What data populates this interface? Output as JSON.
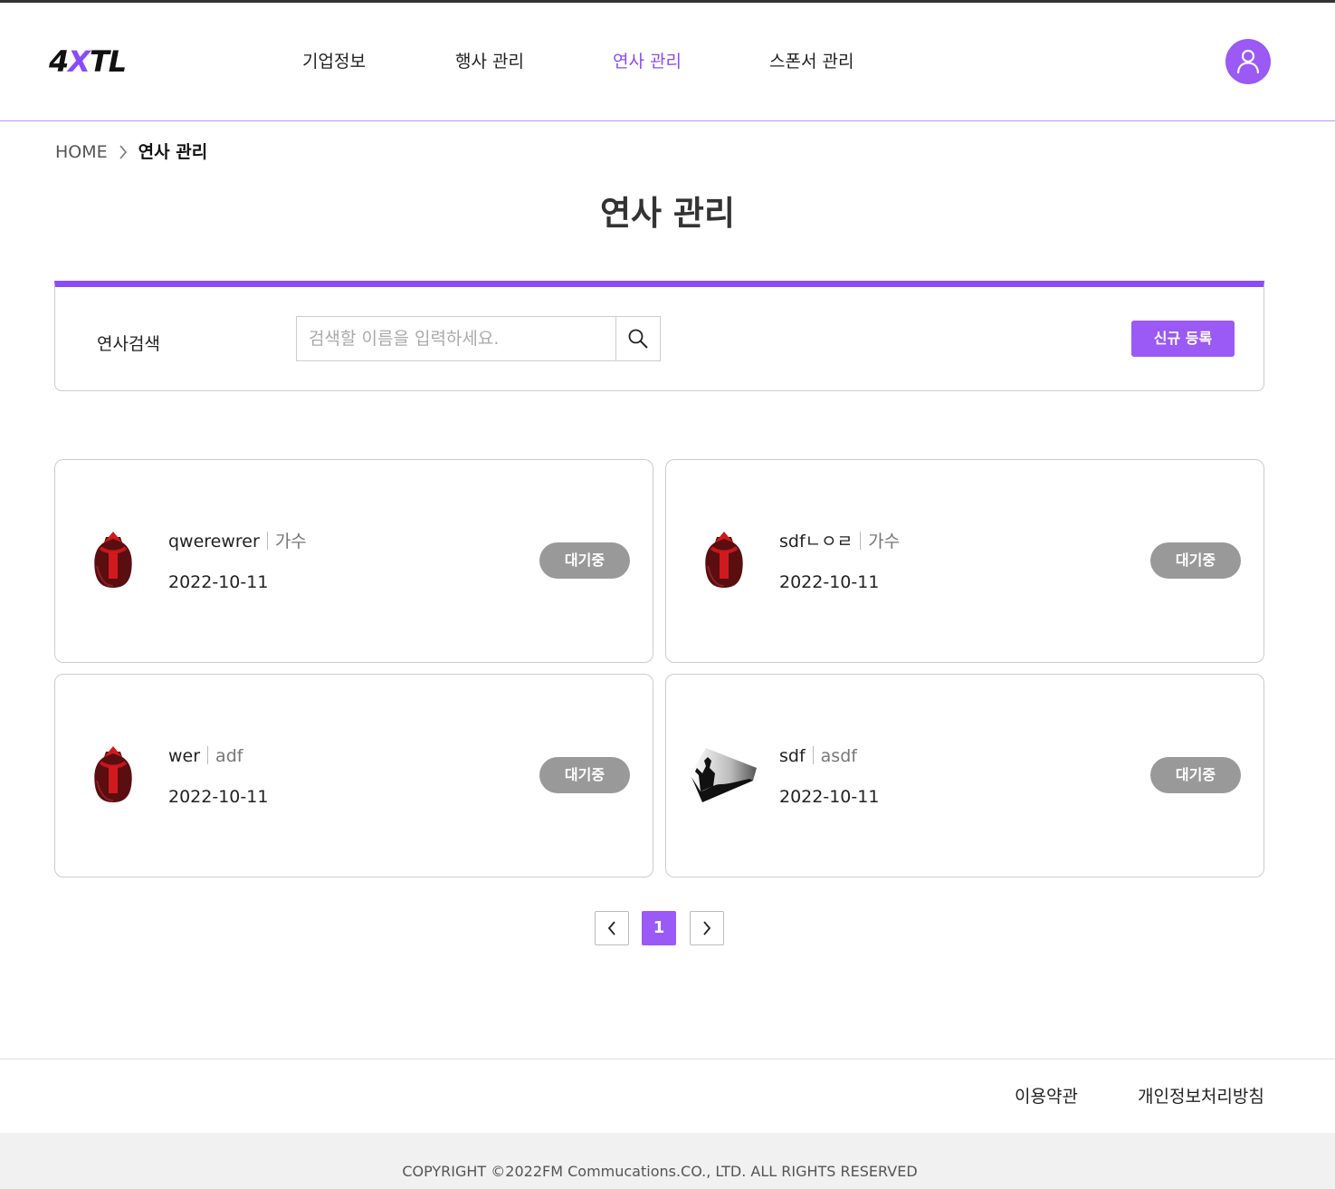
{
  "header": {
    "logo": {
      "part1": "4",
      "part2": "X",
      "part3": "TL"
    },
    "nav": [
      {
        "label": "기업정보",
        "active": false
      },
      {
        "label": "행사 관리",
        "active": false
      },
      {
        "label": "연사 관리",
        "active": true
      },
      {
        "label": "스폰서 관리",
        "active": false
      }
    ],
    "profile_icon": "user-icon"
  },
  "breadcrumb": {
    "home": "HOME",
    "current": "연사 관리"
  },
  "page_title": "연사 관리",
  "search": {
    "label": "연사검색",
    "placeholder": "검색할 이름을 입력하세요.",
    "value": "",
    "button_icon": "search-icon",
    "new_button": "신규 등록"
  },
  "speakers": [
    {
      "name": "qwerewrer",
      "role": "가수",
      "date": "2022-10-11",
      "status": "대기중",
      "image": "jar-image"
    },
    {
      "name": "sdfㄴㅇㄹ",
      "role": "가수",
      "date": "2022-10-11",
      "status": "대기중",
      "image": "jar-image"
    },
    {
      "name": "wer",
      "role": "adf",
      "date": "2022-10-11",
      "status": "대기중",
      "image": "jar-image"
    },
    {
      "name": "sdf",
      "role": "asdf",
      "date": "2022-10-11",
      "status": "대기중",
      "image": "concert-image"
    }
  ],
  "pagination": {
    "prev_icon": "chevron-left-icon",
    "current": "1",
    "next_icon": "chevron-right-icon"
  },
  "footer": {
    "links": [
      "이용약관",
      "개인정보처리방침"
    ],
    "copyright": "COPYRIGHT ©2022FM Commucations.CO., LTD. ALL RIGHTS RESERVED"
  },
  "colors": {
    "accent": "#9b59f5",
    "status_badge": "#999999",
    "text": "#222222"
  }
}
